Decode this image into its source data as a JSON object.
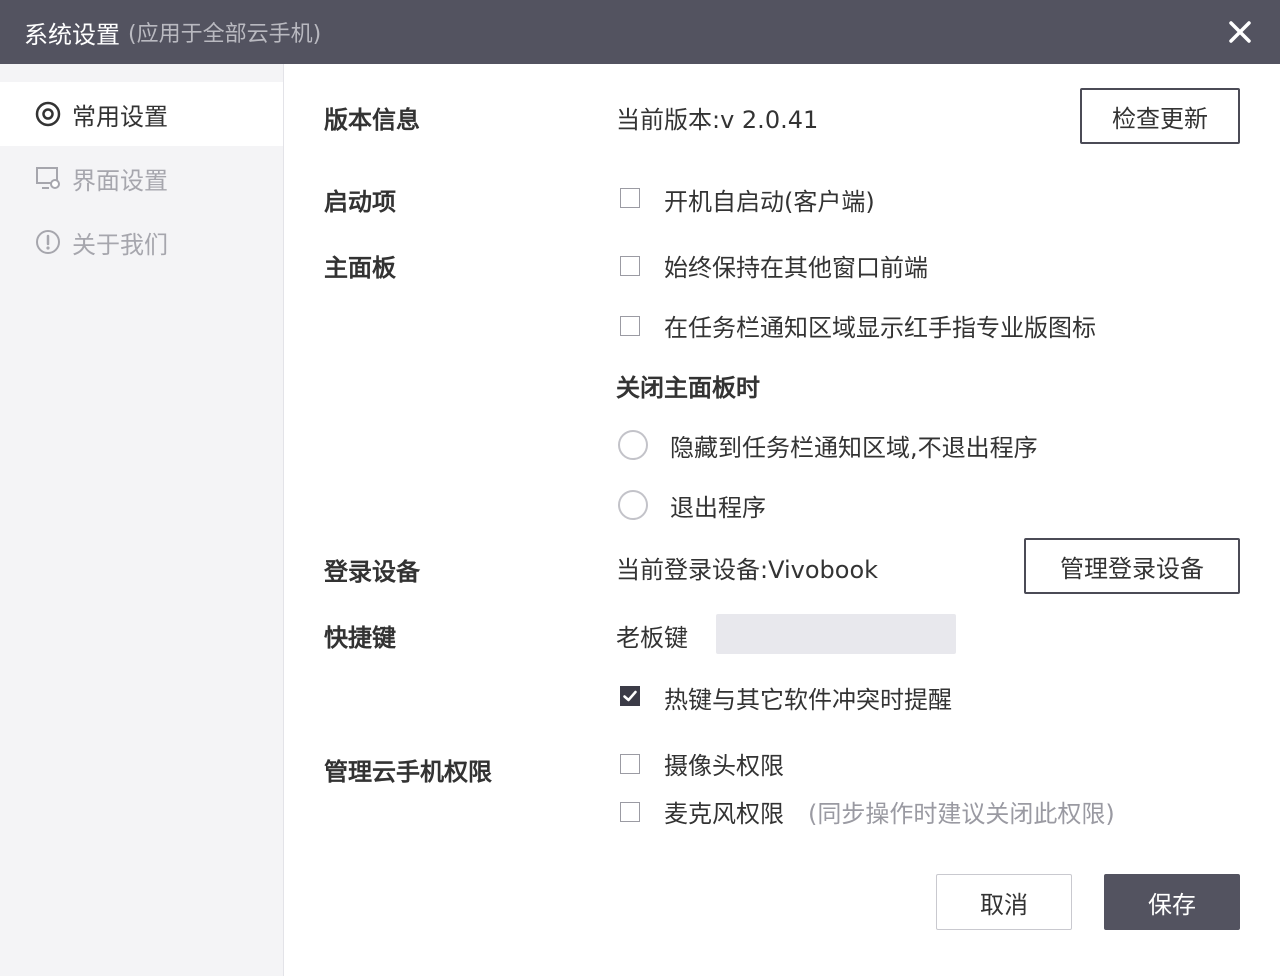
{
  "window": {
    "title": "系统设置",
    "subtitle": "(应用于全部云手机)",
    "close_icon": "close-icon"
  },
  "sidebar": {
    "items": [
      {
        "label": "常用设置",
        "icon": "settings-ring-icon",
        "active": true
      },
      {
        "label": "界面设置",
        "icon": "display-settings-icon",
        "active": false
      },
      {
        "label": "关于我们",
        "icon": "info-exclamation-icon",
        "active": false
      }
    ]
  },
  "sections": {
    "version": {
      "label": "版本信息",
      "current": "当前版本:v 2.0.41",
      "check_update_button": "检查更新"
    },
    "startup": {
      "label": "启动项",
      "autostart": {
        "text": "开机自启动(客户端)",
        "checked": false
      }
    },
    "main_panel": {
      "label": "主面板",
      "always_on_top": {
        "text": "始终保持在其他窗口前端",
        "checked": false
      },
      "tray_icon": {
        "text": "在任务栏通知区域显示红手指专业版图标",
        "checked": false
      },
      "on_close_heading": "关闭主面板时",
      "on_close_options": [
        {
          "text": "隐藏到任务栏通知区域,不退出程序",
          "selected": false
        },
        {
          "text": "退出程序",
          "selected": false
        }
      ]
    },
    "login_device": {
      "label": "登录设备",
      "current": "当前登录设备:Vivobook",
      "manage_button": "管理登录设备"
    },
    "hotkeys": {
      "label": "快捷键",
      "boss_key_label": "老板键",
      "boss_key_value": "",
      "conflict_reminder": {
        "text": "热键与其它软件冲突时提醒",
        "checked": true
      }
    },
    "permissions": {
      "label": "管理云手机权限",
      "camera": {
        "text": "摄像头权限",
        "checked": false
      },
      "microphone": {
        "text": "麦克风权限",
        "checked": false,
        "hint": "(同步操作时建议关闭此权限)"
      }
    }
  },
  "footer": {
    "cancel_button": "取消",
    "save_button": "保存"
  },
  "colors": {
    "titlebar": "#535360",
    "sidebar_bg": "#f4f4f6",
    "primary_button": "#535360",
    "checked_box": "#3b3b47"
  }
}
